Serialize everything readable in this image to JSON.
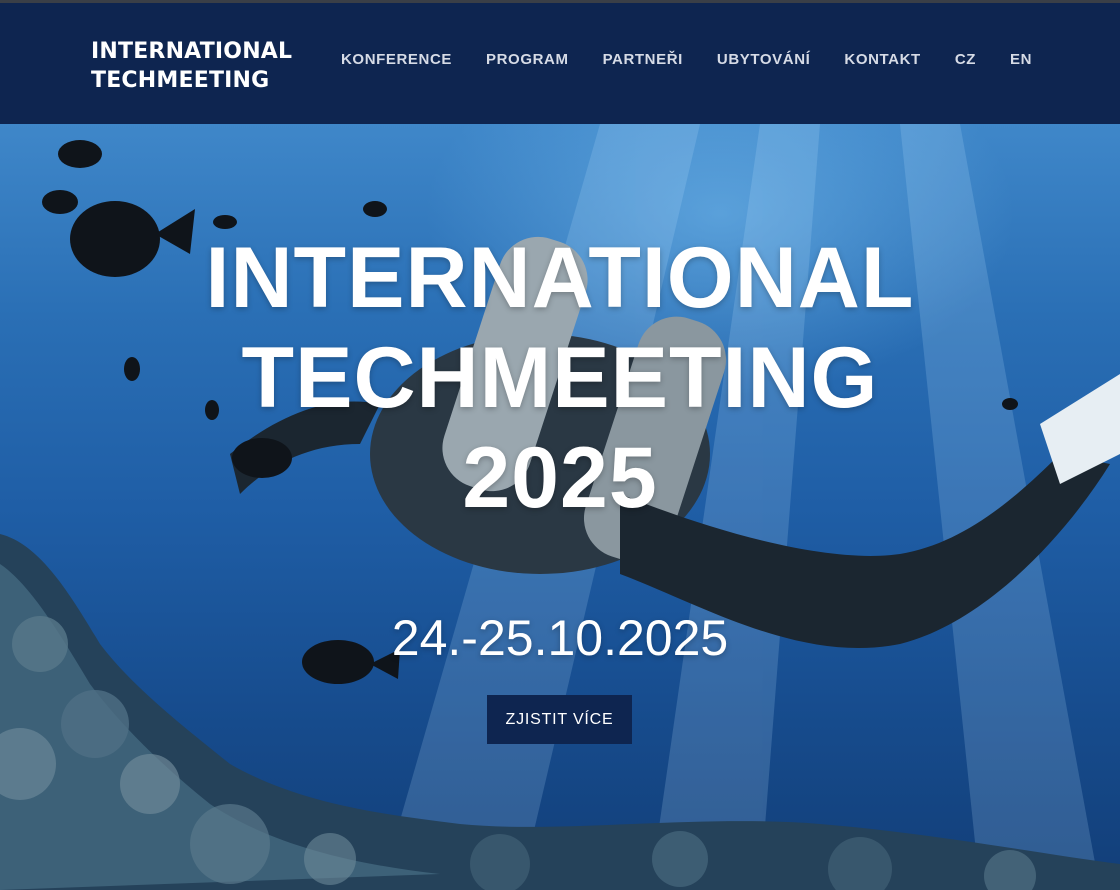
{
  "brand": {
    "line1": "INTERNATIONAL",
    "line2": "TECHMEETING"
  },
  "nav": {
    "items": [
      {
        "label": "KONFERENCE"
      },
      {
        "label": "PROGRAM"
      },
      {
        "label": "PARTNEŘI"
      },
      {
        "label": "UBYTOVÁNÍ"
      },
      {
        "label": "KONTAKT"
      },
      {
        "label": "CZ"
      },
      {
        "label": "EN"
      }
    ]
  },
  "hero": {
    "title_line1": "INTERNATIONAL",
    "title_line2": "TECHMEETING",
    "title_line3": "2025",
    "date": "24.-25.10.2025",
    "cta_label": "ZJISTIT VÍCE"
  },
  "colors": {
    "header_bg": "#0e2550",
    "button_bg": "#0e2550",
    "text": "#ffffff"
  }
}
